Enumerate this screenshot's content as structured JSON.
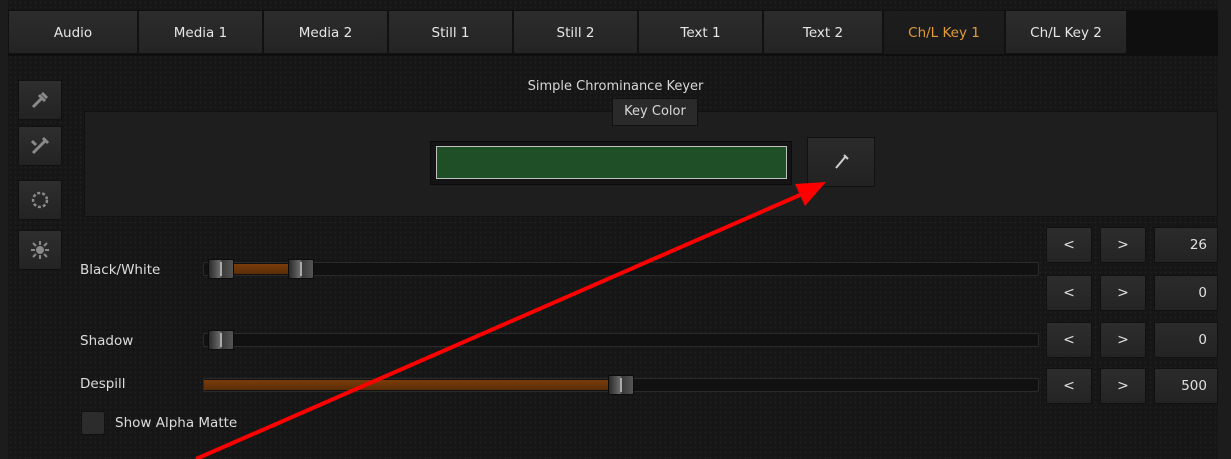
{
  "tabs": [
    {
      "label": "Audio"
    },
    {
      "label": "Media 1"
    },
    {
      "label": "Media 2"
    },
    {
      "label": "Still 1"
    },
    {
      "label": "Still 2"
    },
    {
      "label": "Text 1"
    },
    {
      "label": "Text 2"
    },
    {
      "label": "Ch/L Key 1"
    },
    {
      "label": "Ch/L Key 2"
    }
  ],
  "active_tab": "Ch/L Key 1",
  "tools": [
    "key-brush-icon",
    "eraser-wand-icon",
    "circle-dots-icon",
    "sun-gear-icon"
  ],
  "panel": {
    "title": "Simple Chrominance Keyer",
    "key_color_label": "Key Color",
    "key_color": "#1f4f27"
  },
  "sliders": [
    {
      "label": "Black/White",
      "value": "26",
      "second_value": "0"
    },
    {
      "label": "Shadow",
      "value": "0"
    },
    {
      "label": "Despill",
      "value": "500"
    }
  ],
  "spin": {
    "prev": "<",
    "next": ">"
  },
  "show_alpha_matte": {
    "label": "Show Alpha Matte",
    "checked": false
  },
  "colors": {
    "accent": "#e39a3a",
    "fill": "#7a3d0a",
    "annotation": "#ff0000"
  }
}
